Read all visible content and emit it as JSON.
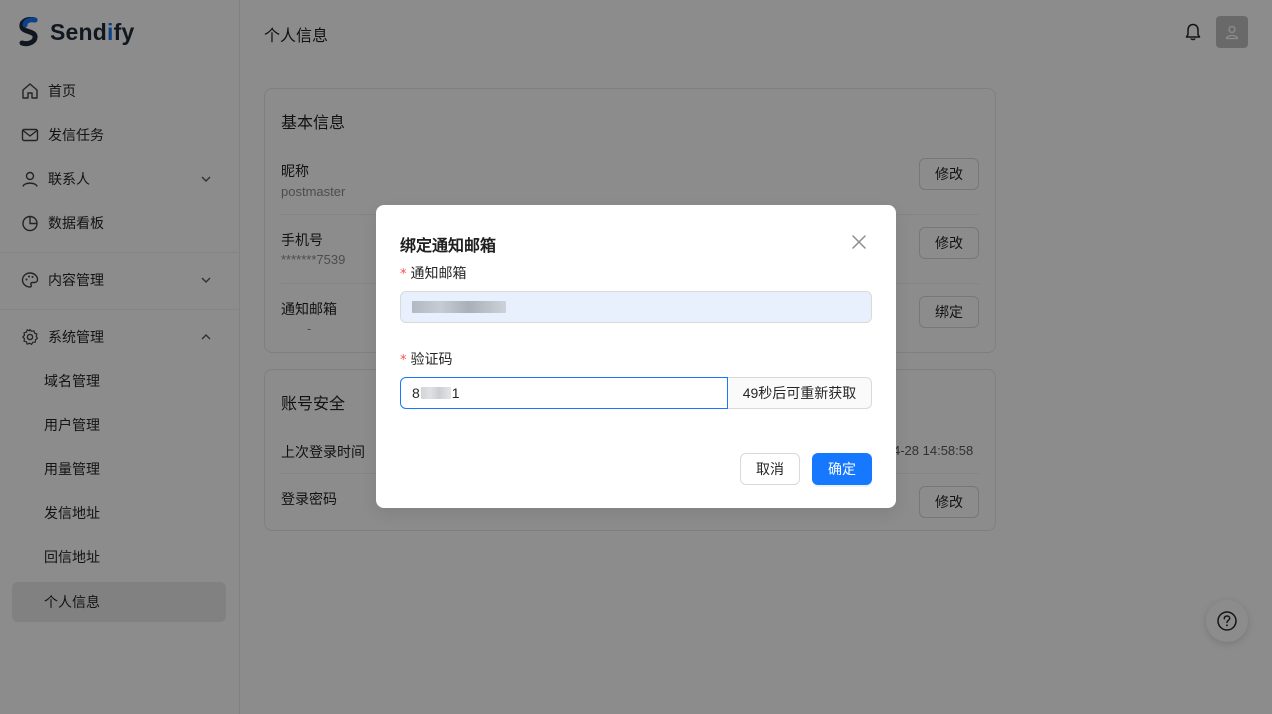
{
  "app": {
    "brand_prefix": "Send",
    "brand_accent": "i",
    "brand_suffix": "fy",
    "accent_color": "#1677ff"
  },
  "sidebar": {
    "items": [
      {
        "label": "首页",
        "icon": "home-icon"
      },
      {
        "label": "发信任务",
        "icon": "mail-icon"
      },
      {
        "label": "联系人",
        "icon": "user-icon",
        "expandable": true,
        "expanded": false
      },
      {
        "label": "数据看板",
        "icon": "pie-chart-icon"
      },
      {
        "label": "内容管理",
        "icon": "palette-icon",
        "expandable": true,
        "expanded": false
      },
      {
        "label": "系统管理",
        "icon": "gear-icon",
        "expandable": true,
        "expanded": true
      }
    ],
    "sub_items": [
      {
        "label": "域名管理"
      },
      {
        "label": "用户管理"
      },
      {
        "label": "用量管理"
      },
      {
        "label": "发信地址"
      },
      {
        "label": "回信地址"
      },
      {
        "label": "个人信息",
        "active": true
      }
    ]
  },
  "header": {
    "title": "个人信息"
  },
  "basic_info": {
    "title": "基本信息",
    "nickname_label": "昵称",
    "nickname_value": "postmaster",
    "nickname_button": "修改",
    "phone_label": "手机号",
    "phone_value": "*******7539",
    "phone_button": "修改",
    "email_label": "通知邮箱",
    "email_value": "-",
    "email_button": "绑定"
  },
  "account_security": {
    "title": "账号安全",
    "last_login_label": "上次登录时间",
    "last_login_value": "4-28 14:58:58",
    "password_label": "登录密码",
    "password_button": "修改"
  },
  "modal": {
    "title": "绑定通知邮箱",
    "email_label": "通知邮箱",
    "code_label": "验证码",
    "code_prefix": "8",
    "code_suffix": "1",
    "resend_label": "49秒后可重新获取",
    "cancel_label": "取消",
    "ok_label": "确定"
  }
}
